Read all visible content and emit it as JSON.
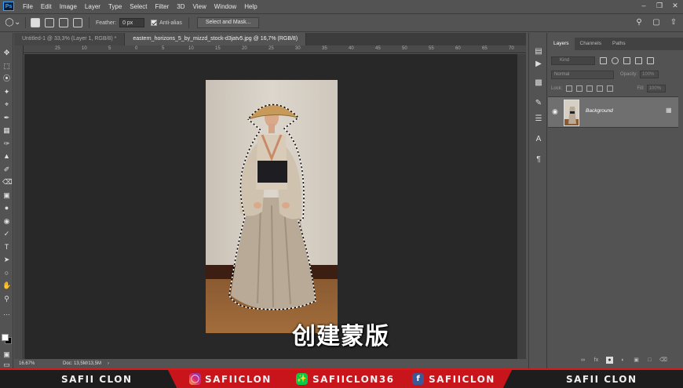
{
  "app": {
    "logo": "Ps"
  },
  "menu": [
    "File",
    "Edit",
    "Image",
    "Layer",
    "Type",
    "Select",
    "Filter",
    "3D",
    "View",
    "Window",
    "Help"
  ],
  "window_controls": [
    "minimize-icon",
    "restore-icon",
    "close-icon"
  ],
  "options": {
    "feather_label": "Feather:",
    "feather_value": "0 px",
    "antialias_label": "Anti-alias",
    "antialias_checked": true,
    "select_mask_label": "Select and Mask..."
  },
  "tabs": [
    {
      "label": "Untitled-1 @ 33,3% (Layer 1, RGB/8) *",
      "active": false
    },
    {
      "label": "eastern_horizons_5_by_mizzd_stock-d3jatv5.jpg @ 16,7% (RGB/8)",
      "active": true
    }
  ],
  "ruler_top": [
    "25",
    "10",
    "5",
    "0",
    "5",
    "10",
    "15",
    "20",
    "25",
    "30",
    "35",
    "40",
    "45",
    "50",
    "55",
    "60",
    "65",
    "70"
  ],
  "status": {
    "zoom": "16.67%",
    "doc": "Doc: 13,5M/13,5M"
  },
  "subtitle": "创建蒙版",
  "layers_panel": {
    "tabs": [
      "Layers",
      "Channels",
      "Paths"
    ],
    "kind_placeholder": "Kind",
    "blend_mode": "Normal",
    "opacity_label": "Opacity:",
    "opacity_value": "100%",
    "lock_label": "Lock:",
    "fill_label": "Fill:",
    "fill_value": "100%",
    "layer_name": "Background"
  },
  "banner": {
    "left_name": "SAFII CLON",
    "instagram": "SAFIICLON",
    "deviantart": "SAFIICLON36",
    "facebook": "SAFIICLON",
    "right_name": "SAFII CLON"
  }
}
